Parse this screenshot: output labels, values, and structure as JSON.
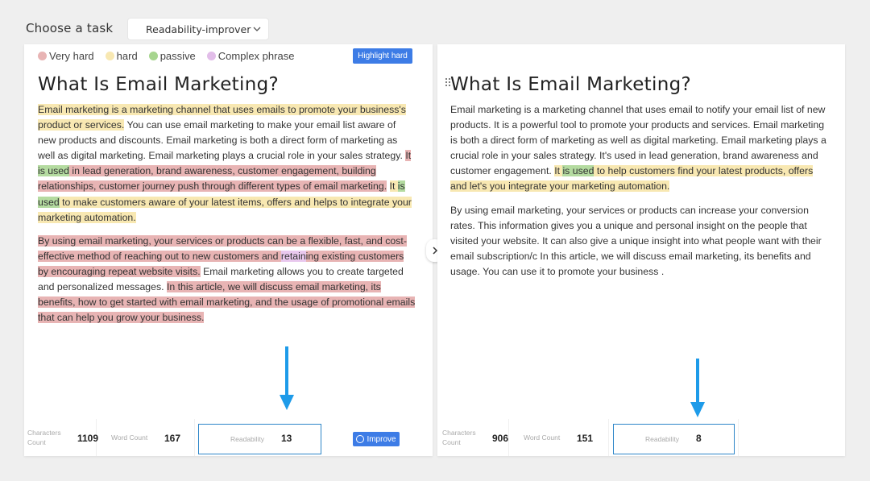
{
  "header": {
    "choose_label": "Choose a task",
    "task_value": "Readability-improver"
  },
  "legend": [
    {
      "label": "Very hard",
      "color": "#e8b4b4"
    },
    {
      "label": "hard",
      "color": "#f8e8b2"
    },
    {
      "label": "passive",
      "color": "#a7d58f"
    },
    {
      "label": "Complex phrase",
      "color": "#e2bde9"
    }
  ],
  "highlight_button": "Highlight hard",
  "left": {
    "title": "What Is Email Marketing?",
    "p1": {
      "a": "Email marketing is a marketing channel that uses emails to promote your business's product or services.",
      "b": " You can use email marketing to make your email list aware of new products and discounts. Email marketing is both a direct form of marketing as well as digital marketing. Email marketing plays a crucial role in your sales strategy. ",
      "c1": "It ",
      "c2": "is used",
      "c3": " in lead generation, brand awareness, customer engagement, building relationships, customer journey push through different types of email marketing.",
      "d": " ",
      "e1": "It ",
      "e2": "is used",
      "e3": " to make customers aware of your latest items, offers and helps to integrate your marketing automation."
    },
    "p2": {
      "a1": "By using email marketing, your services or products can be a flexible, fast, and cost-effective method of reaching out to new customers and ",
      "a2": "retain",
      "a3": "ing existing customers by encouraging repeat website visits.",
      "b": " Email marketing allows you to create targeted and personalized messages. ",
      "c": "In this article, we will discuss email marketing, its benefits, how to get started with email marketing, and the usage of promotional emails that can help you grow your business."
    },
    "stats": {
      "characters_label": "Characters Count",
      "characters_value": "1109",
      "word_label": "Word Count",
      "word_value": "167",
      "readability_label": "Readability",
      "readability_value": "13",
      "improve_label": "Improve"
    }
  },
  "right": {
    "title": "What Is Email Marketing?",
    "p1": {
      "a": "Email marketing is a marketing channel that uses email to notify your email list of new products. It is a powerful tool to promote your products and services. Email marketing is both a direct form of marketing as well as digital marketing. Email marketing plays a crucial role in your sales strategy. It's used in lead generation, brand awareness and customer engagement. ",
      "b1": "It ",
      "b2": "is used",
      "b3": " to help customers find your latest products, offers and let's you integrate your marketing automation."
    },
    "p2": "By using email marketing, your services or products can increase your conversion rates. This information gives you a unique and personal insight on the people that visited your website. It can also give a unique insight into what people want with their email subscription/c In this article, we will discuss email marketing, its benefits and usage. You can use it to promote your business .",
    "stats": {
      "characters_label": "Characters Count",
      "characters_value": "906",
      "word_label": "Word Count",
      "word_value": "151",
      "readability_label": "Readability",
      "readability_value": "8"
    }
  },
  "colors": {
    "accent": "#3d7ce6",
    "arrow": "#1e9be9",
    "readability_border": "#2d86c8"
  }
}
